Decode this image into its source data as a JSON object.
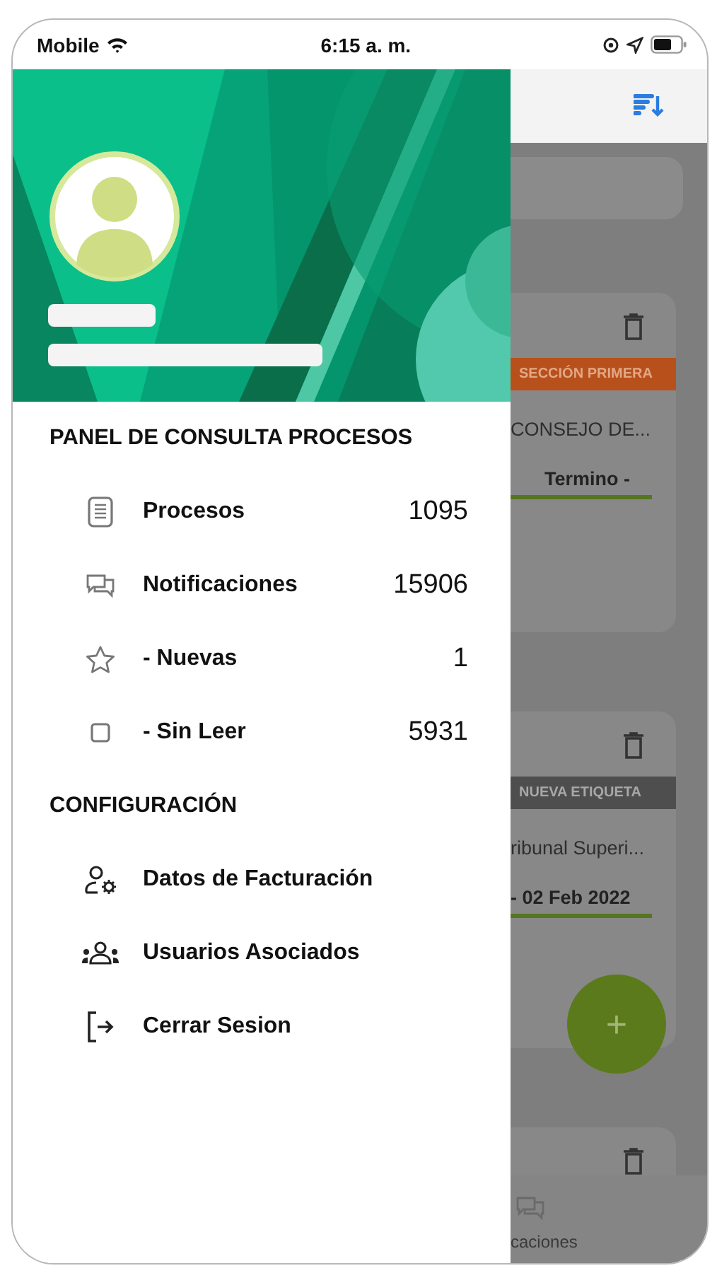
{
  "status_bar": {
    "carrier": "Mobile",
    "time": "6:15 a. m."
  },
  "drawer": {
    "sections": [
      {
        "title": "PANEL DE CONSULTA PROCESOS",
        "items": [
          {
            "kind": "document",
            "label": "Procesos",
            "count": "1095"
          },
          {
            "kind": "chat",
            "label": "Notificaciones",
            "count": "15906"
          },
          {
            "kind": "star",
            "label": "- Nuevas",
            "count": "1"
          },
          {
            "kind": "square",
            "label": "- Sin Leer",
            "count": "5931"
          }
        ]
      },
      {
        "title": "CONFIGURACIÓN",
        "items": [
          {
            "kind": "user-gear",
            "label": "Datos de Facturación"
          },
          {
            "kind": "users",
            "label": "Usuarios Asociados"
          },
          {
            "kind": "logout",
            "label": "Cerrar Sesion"
          }
        ]
      }
    ]
  },
  "background": {
    "cards": [
      {
        "tag": "SECCIÓN PRIMERA",
        "color": "#b8501c",
        "text": "CONSEJO DE...",
        "date": "Termino -"
      },
      {
        "tag": "NUEVA ETIQUETA",
        "color": "#4e4e4e",
        "text": "ribunal Superi...",
        "date": "- 02 Feb 2022"
      }
    ],
    "partial_card": true,
    "fab": "+",
    "tab_label": "caciones"
  }
}
